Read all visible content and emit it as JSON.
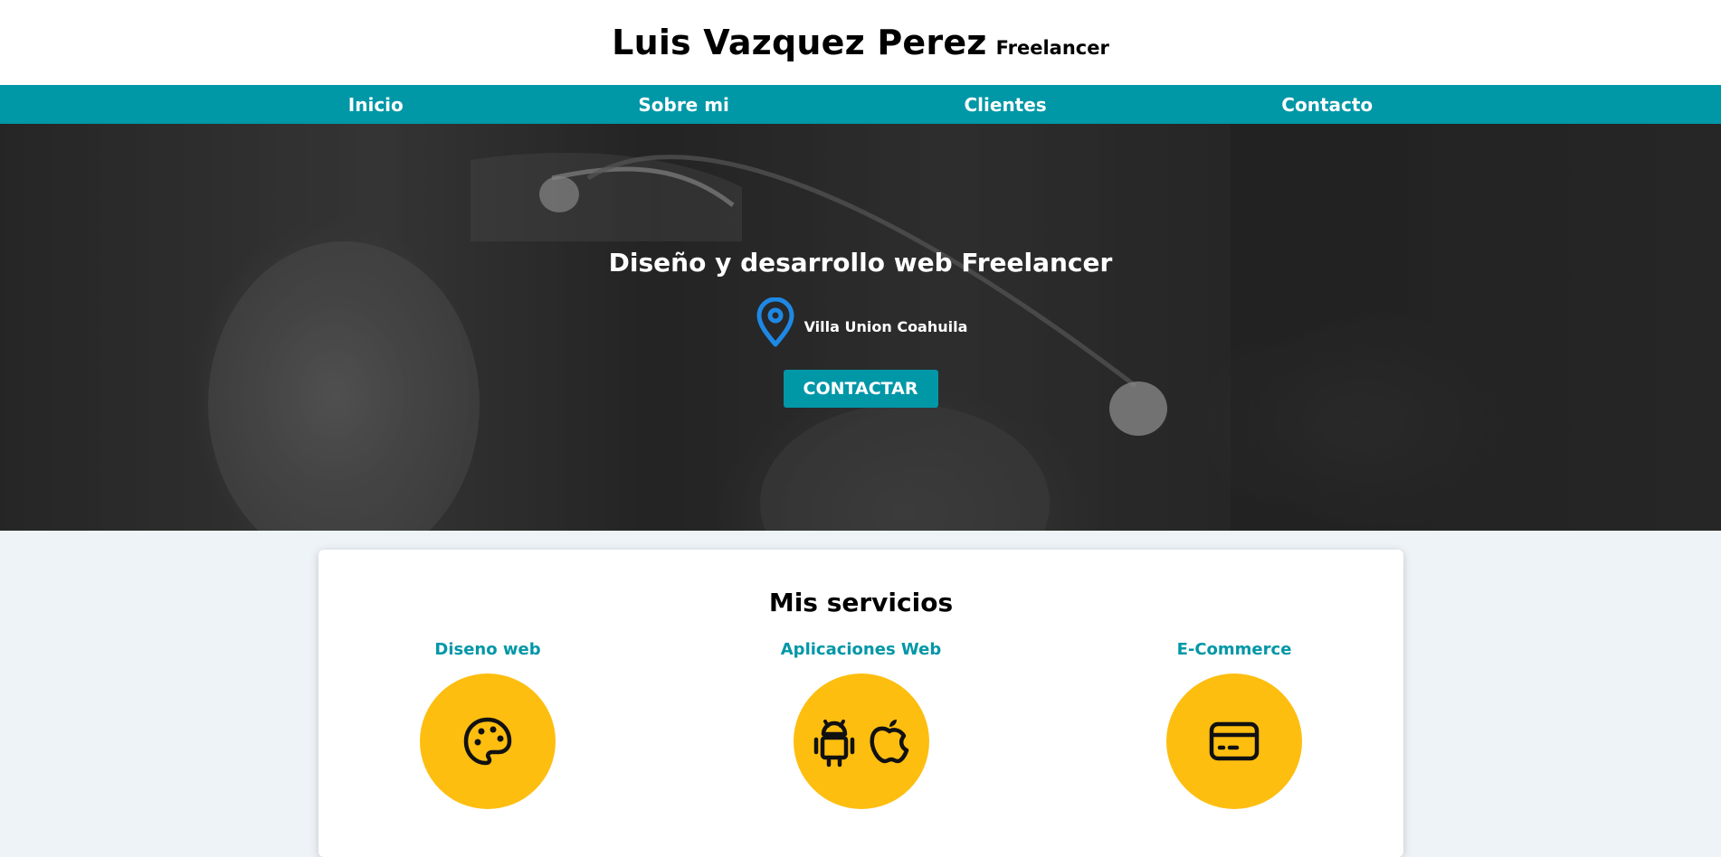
{
  "header": {
    "name": "Luis Vazquez Perez",
    "role": "Freelancer"
  },
  "nav": {
    "items": [
      "Inicio",
      "Sobre mi",
      "Clientes",
      "Contacto"
    ]
  },
  "hero": {
    "title": "Diseño y desarrollo web Freelancer",
    "location_icon": "map-pin-icon",
    "location": "Villa Union Coahuila",
    "cta_label": "CONTACTAR"
  },
  "services": {
    "title": "Mis servicios",
    "items": [
      {
        "label": "Diseno web",
        "icons": [
          "palette-icon"
        ]
      },
      {
        "label": "Aplicaciones Web",
        "icons": [
          "android-icon",
          "apple-icon"
        ]
      },
      {
        "label": "E-Commerce",
        "icons": [
          "credit-card-icon"
        ]
      }
    ]
  },
  "colors": {
    "accent": "#0097a7",
    "circle": "#fdbe10",
    "pin": "#1e88e5"
  }
}
